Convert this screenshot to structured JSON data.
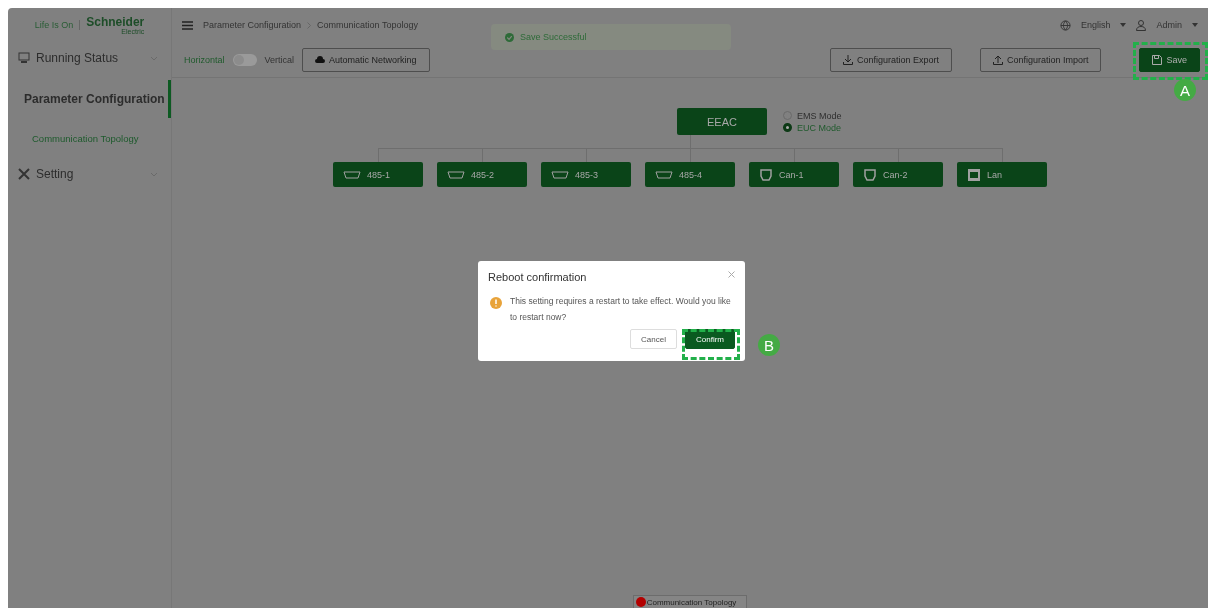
{
  "brand": {
    "tagline": "Life Is On",
    "name": "Schneider",
    "sub": "Electric"
  },
  "sidebar": {
    "items": [
      {
        "label": "Running Status",
        "selected": false,
        "expanded": false
      },
      {
        "label": "Parameter Configuration",
        "selected": true,
        "expanded": true,
        "children": [
          {
            "label": "Communication Topology",
            "selected": true
          }
        ]
      },
      {
        "label": "Setting",
        "selected": false,
        "expanded": false
      }
    ]
  },
  "breadcrumb": [
    "Parameter Configuration",
    "Communication Topology"
  ],
  "toast": {
    "message": "Save Successful"
  },
  "header": {
    "language": "English",
    "user": "Admin"
  },
  "toolbar": {
    "layout_left": "Horizontal",
    "layout_right": "Vertical",
    "vertical_on": false,
    "auto_button": "Automatic Networking",
    "export_button": "Configuration Export",
    "import_button": "Configuration Import",
    "save_button": "Save"
  },
  "topology": {
    "root": "EEAC",
    "modes": [
      {
        "label": "EMS Mode",
        "selected": false
      },
      {
        "label": "EUC Mode",
        "selected": true
      }
    ],
    "ports": [
      {
        "label": "485-1",
        "kind": "serial"
      },
      {
        "label": "485-2",
        "kind": "serial"
      },
      {
        "label": "485-3",
        "kind": "serial"
      },
      {
        "label": "485-4",
        "kind": "serial"
      },
      {
        "label": "Can-1",
        "kind": "can"
      },
      {
        "label": "Can-2",
        "kind": "can"
      },
      {
        "label": "Lan",
        "kind": "lan"
      }
    ]
  },
  "dialog": {
    "title": "Reboot confirmation",
    "message": "This setting requires a restart to take effect. Would you like to restart now?",
    "cancel": "Cancel",
    "confirm": "Confirm"
  },
  "callouts": [
    "A",
    "B"
  ],
  "bottom_tab": {
    "label": "Communication Topology",
    "color": "#b30000"
  }
}
